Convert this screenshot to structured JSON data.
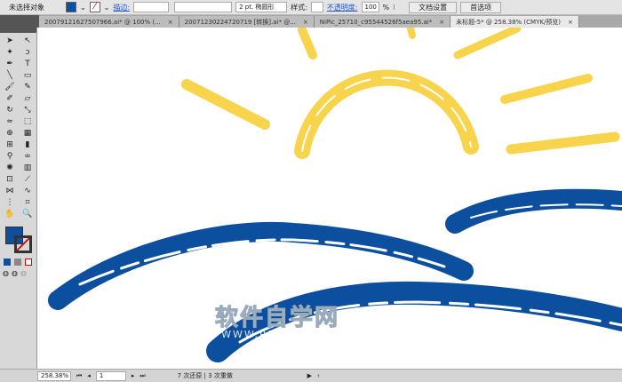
{
  "control_bar": {
    "selection": "未选择对象",
    "fill_color": "#0b4f9e",
    "stroke_label": "描边:",
    "stroke_weight": "",
    "brush": "2 pt. 椭圆形",
    "style_label": "样式:",
    "opacity_label": "不透明度:",
    "opacity_value": "100",
    "opacity_unit": "%",
    "doc_setup": "文档设置",
    "preferences": "首选项"
  },
  "tabs": [
    {
      "label": "20079121627507966.ai* @ 100% (...",
      "active": false
    },
    {
      "label": "20071230224720719 [转换].ai* @...",
      "active": false
    },
    {
      "label": "NiPic_25710_c95544526f5aea95.ai*",
      "active": false
    },
    {
      "label": "未标题-5* @ 258.38% (CMYK/预览)",
      "active": true
    }
  ],
  "tools": [
    "selection",
    "direct-selection",
    "magic-wand",
    "lasso",
    "pen",
    "type",
    "line",
    "rectangle",
    "paintbrush",
    "pencil",
    "blob-brush",
    "eraser",
    "rotate",
    "scale",
    "warp",
    "free-transform",
    "shape-builder",
    "perspective-grid",
    "mesh",
    "gradient",
    "eyedropper",
    "blend",
    "symbol-sprayer",
    "column-graph",
    "artboard",
    "slice",
    "width",
    "warp-alt",
    "symbol",
    "crop",
    "hand",
    "zoom"
  ],
  "colors": {
    "blue": "#0b4f9e",
    "yellow": "#f7d44c"
  },
  "watermark": {
    "cn": "软件自学网",
    "url": "WWW.RJZXW.COM"
  },
  "status": {
    "zoom": "258.38%",
    "page": "1",
    "history": "7 次还原 | 3 次重做"
  }
}
